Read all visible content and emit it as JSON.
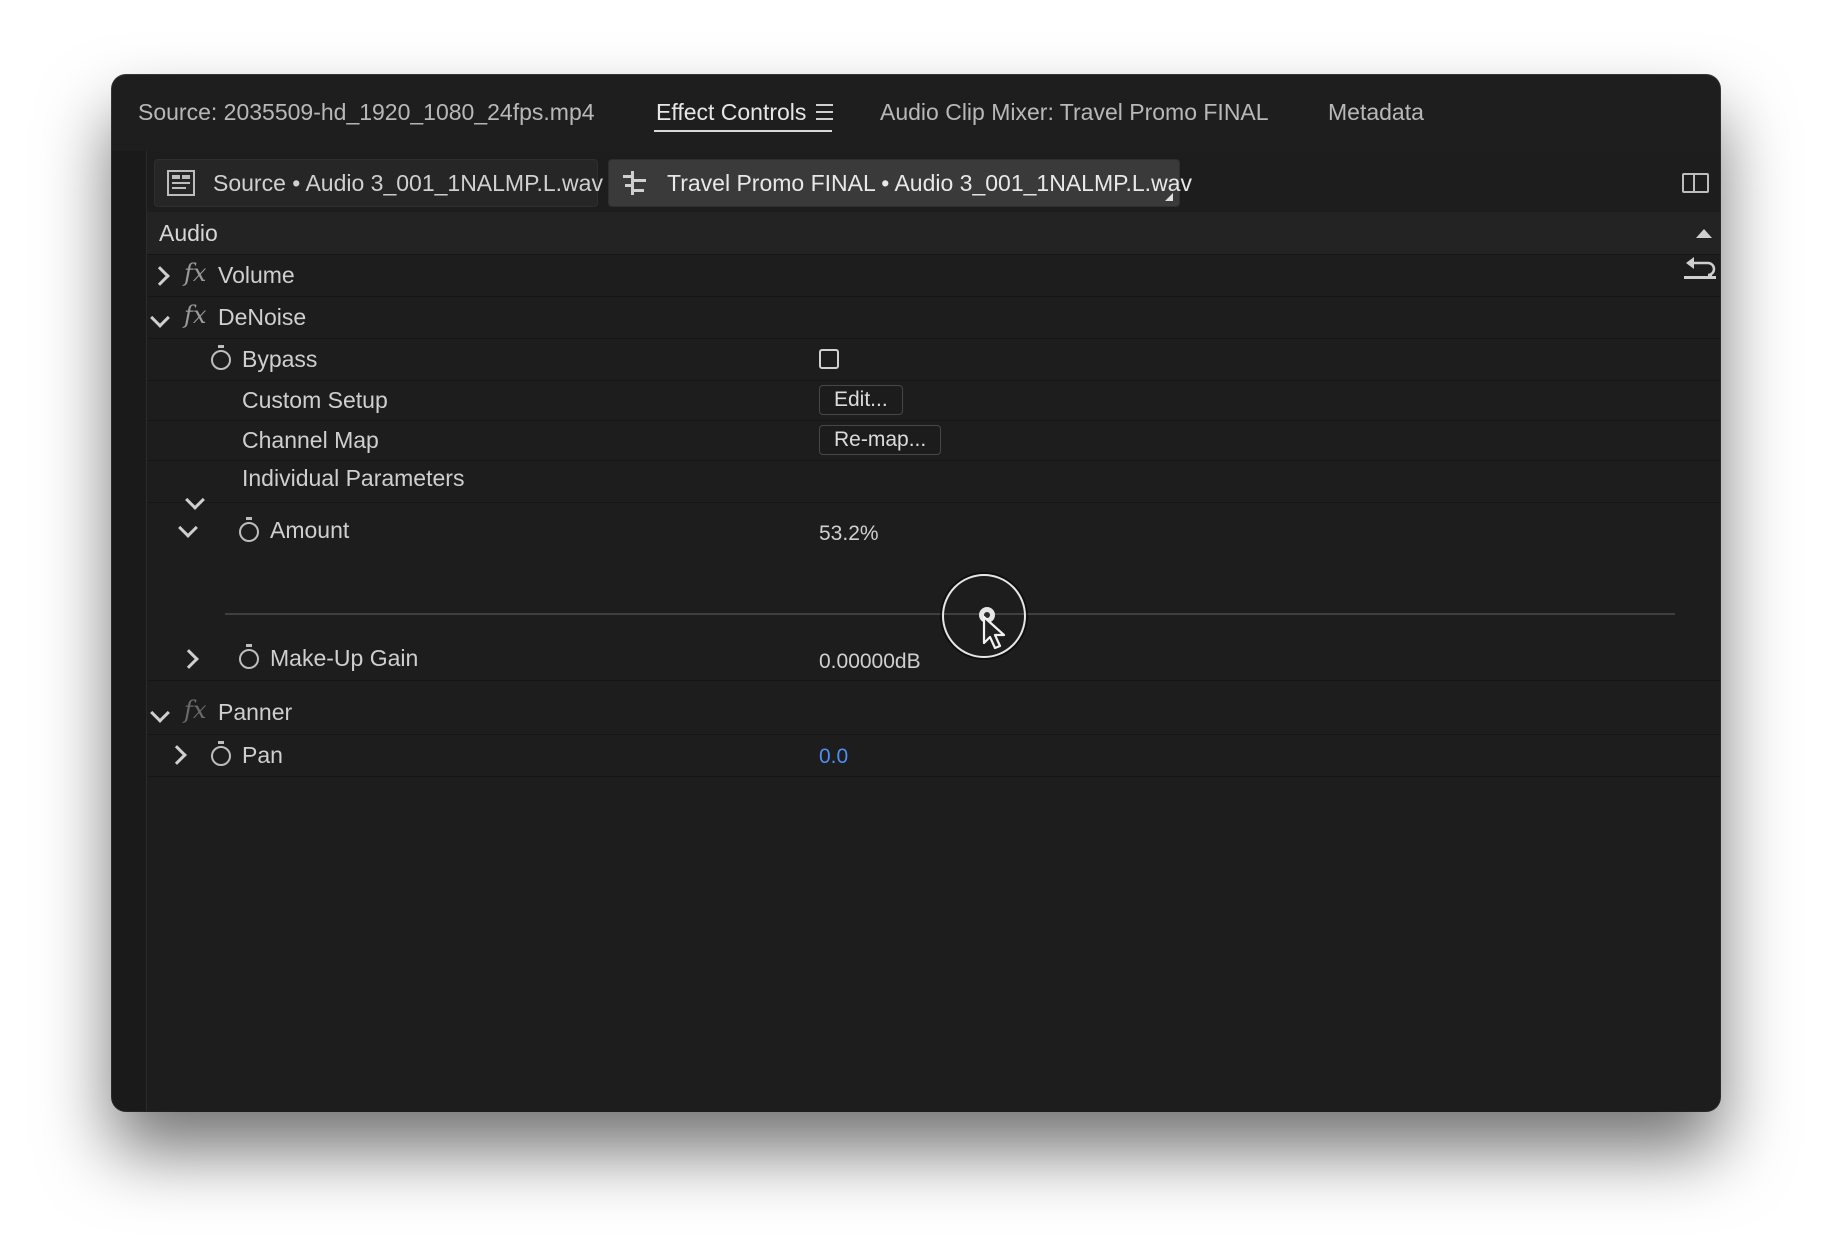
{
  "tabs": {
    "source": "Source: 2035509-hd_1920_1080_24fps.mp4",
    "effect_controls": "Effect Controls",
    "audio_clip_mixer": "Audio Clip Mixer: Travel Promo FINAL",
    "metadata": "Metadata"
  },
  "clip_tabs": {
    "source_clip": "Source • Audio 3_001_1NALMP.L.wav",
    "sequence_clip": "Travel Promo FINAL • Audio 3_001_1NALMP.L.wav"
  },
  "section": {
    "audio": "Audio"
  },
  "effects": {
    "volume": "Volume",
    "denoise": "DeNoise",
    "panner": "Panner",
    "fx_symbol": "fx"
  },
  "params": {
    "bypass": "Bypass",
    "custom_setup": "Custom Setup",
    "channel_map": "Channel Map",
    "individual_parameters": "Individual Parameters",
    "amount": "Amount",
    "makeup_gain": "Make-Up Gain",
    "pan": "Pan"
  },
  "values": {
    "edit_button": "Edit...",
    "remap_button": "Re-map...",
    "amount": "53.2%",
    "amount_fraction": 0.532,
    "makeup_gain": "0.00000dB",
    "pan": "0.0",
    "bypass_checked": false
  },
  "colors": {
    "accent_blue": "#4d8ef0",
    "panel_bg": "#1d1d1d"
  }
}
